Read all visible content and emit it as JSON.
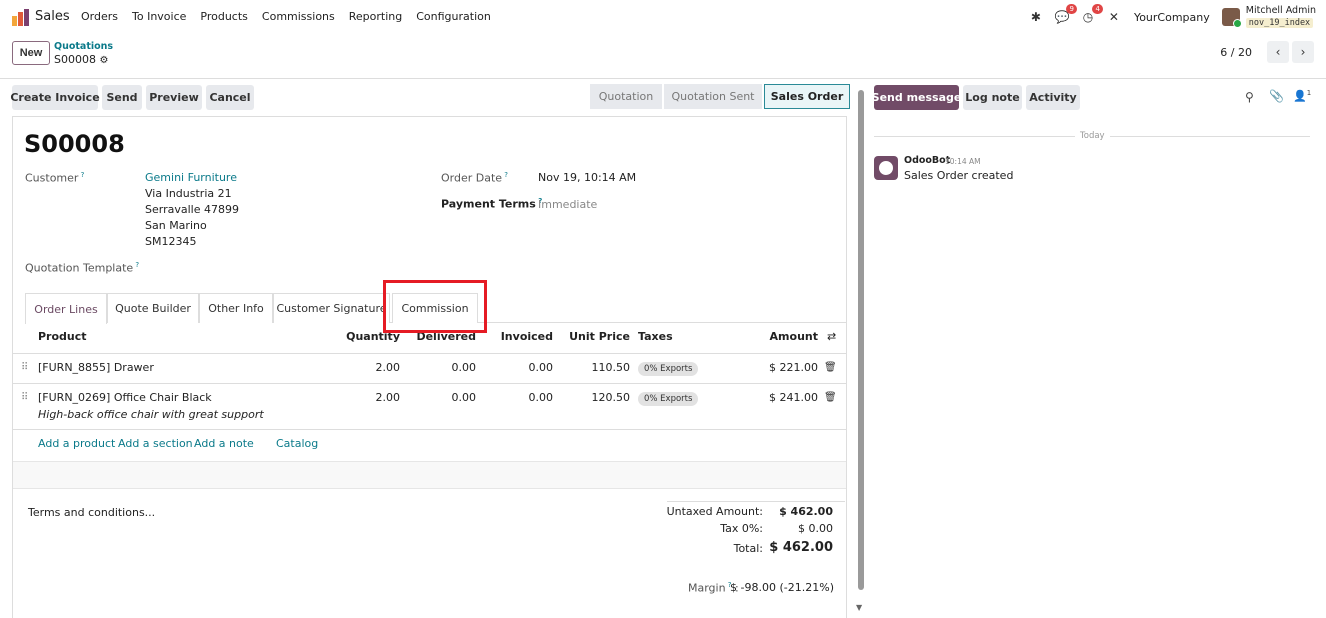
{
  "navbar": {
    "app_name": "Sales",
    "menu": [
      "Orders",
      "To Invoice",
      "Products",
      "Commissions",
      "Reporting",
      "Configuration"
    ],
    "messages_badge": "9",
    "activities_badge": "4",
    "company": "YourCompany",
    "user_name": "Mitchell Admin",
    "database": "nov_19_index"
  },
  "control_panel": {
    "new_label": "New",
    "breadcrumb_parent": "Quotations",
    "breadcrumb_current": "S00008",
    "pager": "6 / 20"
  },
  "actions": {
    "create_invoice": "Create Invoice",
    "send": "Send",
    "preview": "Preview",
    "cancel": "Cancel"
  },
  "stages": [
    "Quotation",
    "Quotation Sent",
    "Sales Order"
  ],
  "active_stage": "Sales Order",
  "record": {
    "name": "S00008",
    "customer_label": "Customer",
    "customer_name": "Gemini Furniture",
    "customer_address": [
      "Via Industria 21",
      "Serravalle 47899",
      "San Marino",
      "SM12345"
    ],
    "order_date_label": "Order Date",
    "order_date": "Nov 19, 10:14 AM",
    "payment_terms_label": "Payment Terms",
    "payment_terms_placeholder": "Immediate",
    "template_label": "Quotation Template"
  },
  "tabs": [
    "Order Lines",
    "Quote Builder",
    "Other Info",
    "Customer Signature",
    "Commission"
  ],
  "lines_table": {
    "headers": [
      "Product",
      "Quantity",
      "Delivered",
      "Invoiced",
      "Unit Price",
      "Taxes",
      "Amount"
    ],
    "rows": [
      {
        "product": "[FURN_8855] Drawer",
        "description": "",
        "quantity": "2.00",
        "delivered": "0.00",
        "invoiced": "0.00",
        "unit_price": "110.50",
        "tax": "0% Exports",
        "amount": "$ 221.00"
      },
      {
        "product": "[FURN_0269] Office Chair Black",
        "description": "High-back office chair with great support",
        "quantity": "2.00",
        "delivered": "0.00",
        "invoiced": "0.00",
        "unit_price": "120.50",
        "tax": "0% Exports",
        "amount": "$ 241.00"
      }
    ],
    "add_product": "Add a product",
    "add_section": "Add a section",
    "add_note": "Add a note",
    "catalog": "Catalog"
  },
  "footer": {
    "terms_placeholder": "Terms and conditions...",
    "untaxed_label": "Untaxed Amount:",
    "untaxed_value": "$ 462.00",
    "tax_label": "Tax 0%:",
    "tax_value": "$ 0.00",
    "total_label": "Total:",
    "total_value": "$ 462.00",
    "margin_label": "Margin",
    "margin_value": "$ -98.00 (-21.21%)"
  },
  "chatter": {
    "send_message": "Send message",
    "log_note": "Log note",
    "activity": "Activity",
    "followers_count": "1",
    "date_separator": "Today",
    "message_author": "OdooBot",
    "message_time": "10:14 AM",
    "message_body": "Sales Order created"
  },
  "colors": {
    "brand": "#714B67",
    "link": "#0b7a8a",
    "highlight": "#e51b24"
  }
}
